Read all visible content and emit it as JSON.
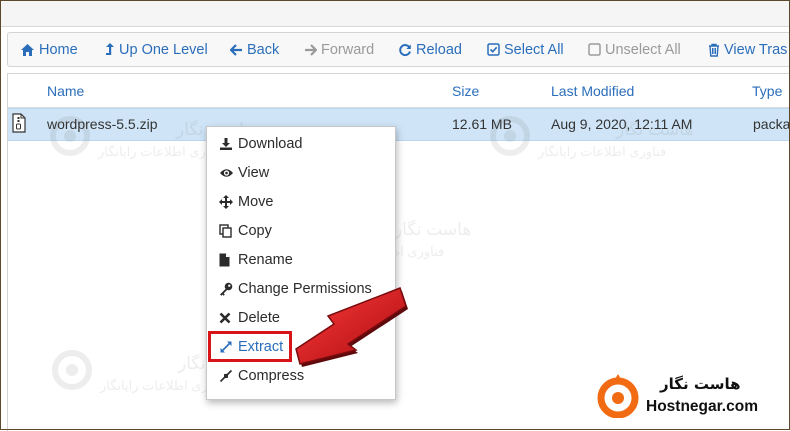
{
  "toolbar": {
    "home": "Home",
    "up_one_level": "Up One Level",
    "back": "Back",
    "forward": "Forward",
    "reload": "Reload",
    "select_all": "Select All",
    "unselect_all": "Unselect All",
    "view_trash": "View Tras"
  },
  "table": {
    "headers": {
      "name": "Name",
      "size": "Size",
      "last_modified": "Last Modified",
      "type": "Type"
    },
    "rows": [
      {
        "name": "wordpress-5.5.zip",
        "size": "12.61 MB",
        "last_modified": "Aug 9, 2020, 12:11 AM",
        "type": "packa"
      }
    ]
  },
  "context_menu": {
    "items": [
      {
        "label": "Download",
        "icon": "download-icon"
      },
      {
        "label": "View",
        "icon": "eye-icon"
      },
      {
        "label": "Move",
        "icon": "move-arrows-icon"
      },
      {
        "label": "Copy",
        "icon": "copy-icon"
      },
      {
        "label": "Rename",
        "icon": "file-icon"
      },
      {
        "label": "Change Permissions",
        "icon": "key-icon"
      },
      {
        "label": "Delete",
        "icon": "close-icon"
      },
      {
        "label": "Extract",
        "icon": "expand-icon"
      },
      {
        "label": "Compress",
        "icon": "compress-icon"
      }
    ],
    "highlighted": "Extract"
  },
  "watermark": {
    "title": "هاست نگار",
    "subtitle": "فناوری اطلاعات رایانگار"
  },
  "branding": {
    "persian_name": "هاست نگار",
    "domain": "Hostnegar.com",
    "accent_color": "#f26a12"
  },
  "colors": {
    "link": "#2a6ebb",
    "selected_row": "#cfe5f7",
    "callout_red": "#d8141b"
  }
}
